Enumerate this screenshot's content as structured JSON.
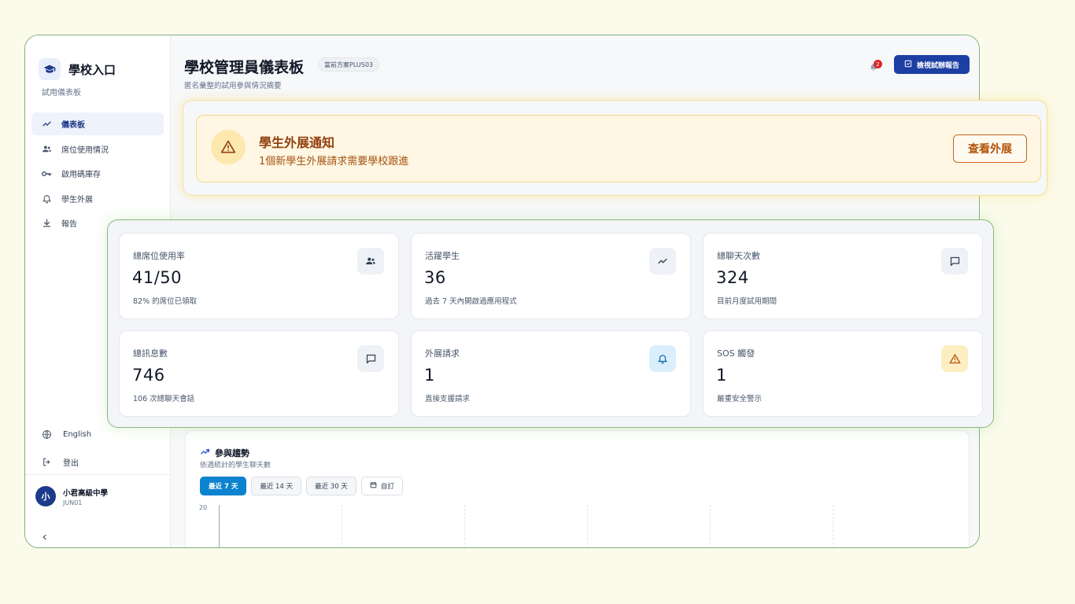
{
  "sidebar": {
    "brand": "學校入口",
    "subtitle": "試用儀表板",
    "nav": [
      {
        "label": "儀表板",
        "icon": "trend-icon"
      },
      {
        "label": "席位使用情況",
        "icon": "users-icon"
      },
      {
        "label": "啟用碼庫存",
        "icon": "key-icon"
      },
      {
        "label": "學生外展",
        "icon": "bell-icon"
      },
      {
        "label": "報告",
        "icon": "download-icon"
      }
    ],
    "language": "English",
    "logout": "登出",
    "user": {
      "avatar": "小",
      "name": "小君高級中學",
      "code": "JUN01"
    }
  },
  "header": {
    "title": "學校管理員儀表板",
    "plan_badge": "當前方案PLUS03",
    "subtitle": "匿名彙整的試用參與情況摘要",
    "notification_count": "2",
    "report_button": "檢視試辦報告"
  },
  "alert": {
    "title": "學生外展通知",
    "text": "1個新學生外展請求需要學校跟進",
    "button": "查看外展"
  },
  "stats": [
    {
      "label": "總席位使用率",
      "value": "41/50",
      "note": "82% 的席位已領取",
      "icon": "users-icon",
      "tone": "gray"
    },
    {
      "label": "活躍學生",
      "value": "36",
      "note": "過去 7 天內開啟過應用程式",
      "icon": "trend-icon",
      "tone": "gray"
    },
    {
      "label": "總聊天次數",
      "value": "324",
      "note": "目前月度試用期間",
      "icon": "chat-icon",
      "tone": "gray"
    },
    {
      "label": "總訊息數",
      "value": "746",
      "note": "106 次總聊天會話",
      "icon": "message-icon",
      "tone": "gray"
    },
    {
      "label": "外展請求",
      "value": "1",
      "note": "直接支援請求",
      "icon": "bell-icon",
      "tone": "blue"
    },
    {
      "label": "SOS 觸發",
      "value": "1",
      "note": "嚴重安全警示",
      "icon": "warning-icon",
      "tone": "amber"
    }
  ],
  "chart": {
    "title": "參與趨勢",
    "subtitle": "依週統計的學生聊天數",
    "ranges": [
      "最近 7 天",
      "最近 14 天",
      "最近 30 天",
      "自訂"
    ],
    "active_range": "最近 7 天",
    "y_tick": "20"
  },
  "colors": {
    "primary": "#1d3fa3",
    "accent_blue": "#0c83cf",
    "alert_text": "#92400e",
    "danger": "#dc2626"
  }
}
